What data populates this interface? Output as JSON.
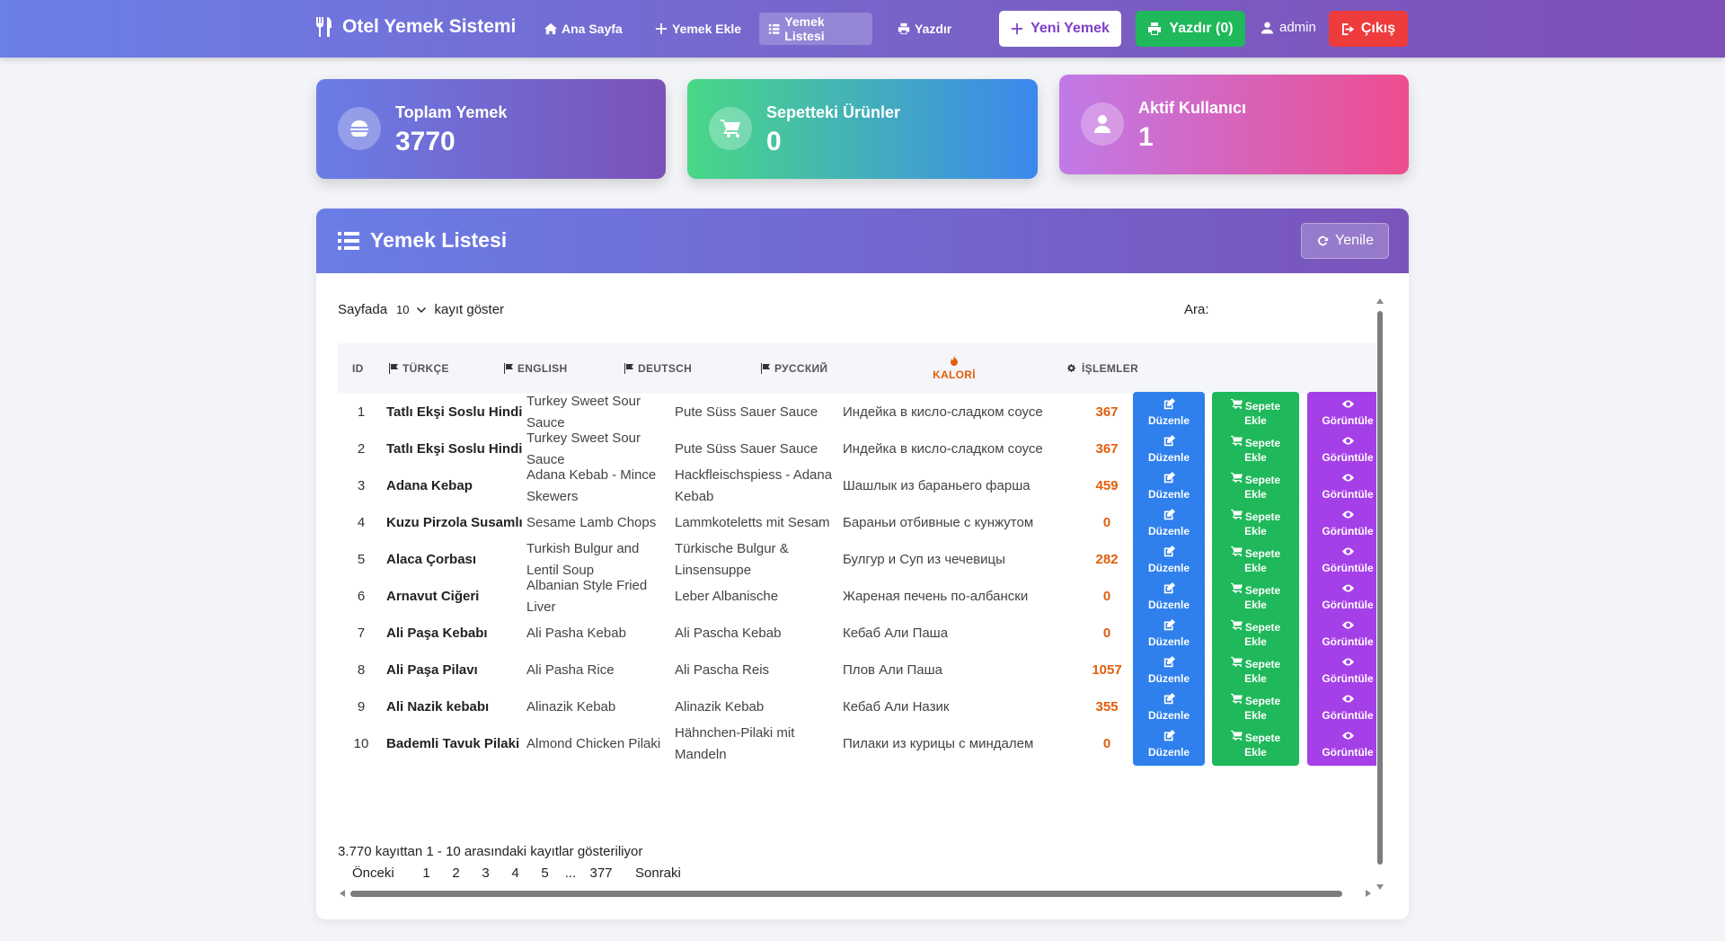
{
  "nav": {
    "brand": "Otel Yemek Sistemi",
    "links": [
      {
        "label": "Ana Sayfa",
        "icon": "home-icon"
      },
      {
        "label": "Yemek Ekle",
        "icon": "plus-icon"
      },
      {
        "label": "Yemek Listesi",
        "icon": "list-icon",
        "active": true
      },
      {
        "label": "Yazdır",
        "icon": "printer-icon"
      }
    ],
    "new_button": "Yeni Yemek",
    "print_button": "Yazdır (0)",
    "user": "admin",
    "logout_button": "Çıkış"
  },
  "stats": {
    "total_label": "Toplam Yemek",
    "total_value": "3770",
    "cart_label": "Sepetteki Ürünler",
    "cart_value": "0",
    "active_label": "Aktif Kullanıcı",
    "active_value": "1"
  },
  "panel": {
    "title": "Yemek Listesi",
    "refresh_button": "Yenile",
    "length_prefix": "Sayfada",
    "length_value": "10",
    "length_suffix": "kayıt göster",
    "search_label": "Ara:",
    "search_value": ""
  },
  "table": {
    "headers": {
      "id": "ID",
      "tr": "TÜRKÇE",
      "en": "ENGLISH",
      "de": "DEUTSCH",
      "ru": "РУССКИЙ",
      "kalori": "KALORİ",
      "actions": "İŞLEMLER"
    },
    "action_labels": {
      "edit": "Düzenle",
      "cart_line1": "Sepete",
      "cart_line2": "Ekle",
      "view": "Görüntüle"
    },
    "rows": [
      {
        "id": "1",
        "tr": "Tatlı Ekşi Soslu Hindi",
        "en": "Turkey Sweet Sour Sauce",
        "de": "Pute Süss Sauer Sauce",
        "ru": "Индейка в кисло-сладком соусе",
        "kalori": "367"
      },
      {
        "id": "2",
        "tr": "Tatlı Ekşi Soslu Hindi",
        "en": "Turkey Sweet Sour Sauce",
        "de": "Pute Süss Sauer Sauce",
        "ru": "Индейка в кисло-сладком соусе",
        "kalori": "367"
      },
      {
        "id": "3",
        "tr": "Adana Kebap",
        "en": "Adana Kebab - Mince Skewers",
        "de": "Hackfleischspiess - Adana Kebab",
        "ru": "Шашлык из бараньего фарша",
        "kalori": "459"
      },
      {
        "id": "4",
        "tr": "Kuzu Pirzola Susamlı",
        "en": "Sesame Lamb Chops",
        "de": "Lammkoteletts mit Sesam",
        "ru": "Бараньи отбивные с кунжутом",
        "kalori": "0"
      },
      {
        "id": "5",
        "tr": "Alaca Çorbası",
        "en": "Turkish Bulgur and Lentil Soup",
        "de": "Türkische Bulgur & Linsensuppe",
        "ru": "Булгур и Суп из чечевицы",
        "kalori": "282"
      },
      {
        "id": "6",
        "tr": "Arnavut Ciğeri",
        "en": "Albanian Style Fried Liver",
        "de": "Leber Albanische",
        "ru": "Жареная печень по-албански",
        "kalori": "0"
      },
      {
        "id": "7",
        "tr": "Ali Paşa Kebabı",
        "en": "Ali Pasha Kebab",
        "de": "Ali Pascha Kebab",
        "ru": "Кебаб Али Паша",
        "kalori": "0"
      },
      {
        "id": "8",
        "tr": "Ali Paşa Pilavı",
        "en": "Ali Pasha Rice",
        "de": "Ali Pascha Reis",
        "ru": "Плов Али Паша",
        "kalori": "1057"
      },
      {
        "id": "9",
        "tr": "Ali Nazik kebabı",
        "en": "Alinazik Kebab",
        "de": "Alinazik Kebab",
        "ru": "Кебаб Али Назик",
        "kalori": "355"
      },
      {
        "id": "10",
        "tr": "Bademli Tavuk Pilaki",
        "en": "Almond Chicken Pilaki",
        "de": "Hähnchen-Pilaki mit Mandeln",
        "ru": "Пилаки из курицы с миндалем",
        "kalori": "0"
      }
    ]
  },
  "footer": {
    "info": "3.770 kayıttan 1 - 10 arasındaki kayıtlar gösteriliyor",
    "prev": "Önceki",
    "pages": [
      "1",
      "2",
      "3",
      "4",
      "5",
      "...",
      "377"
    ],
    "next": "Sonraki"
  }
}
